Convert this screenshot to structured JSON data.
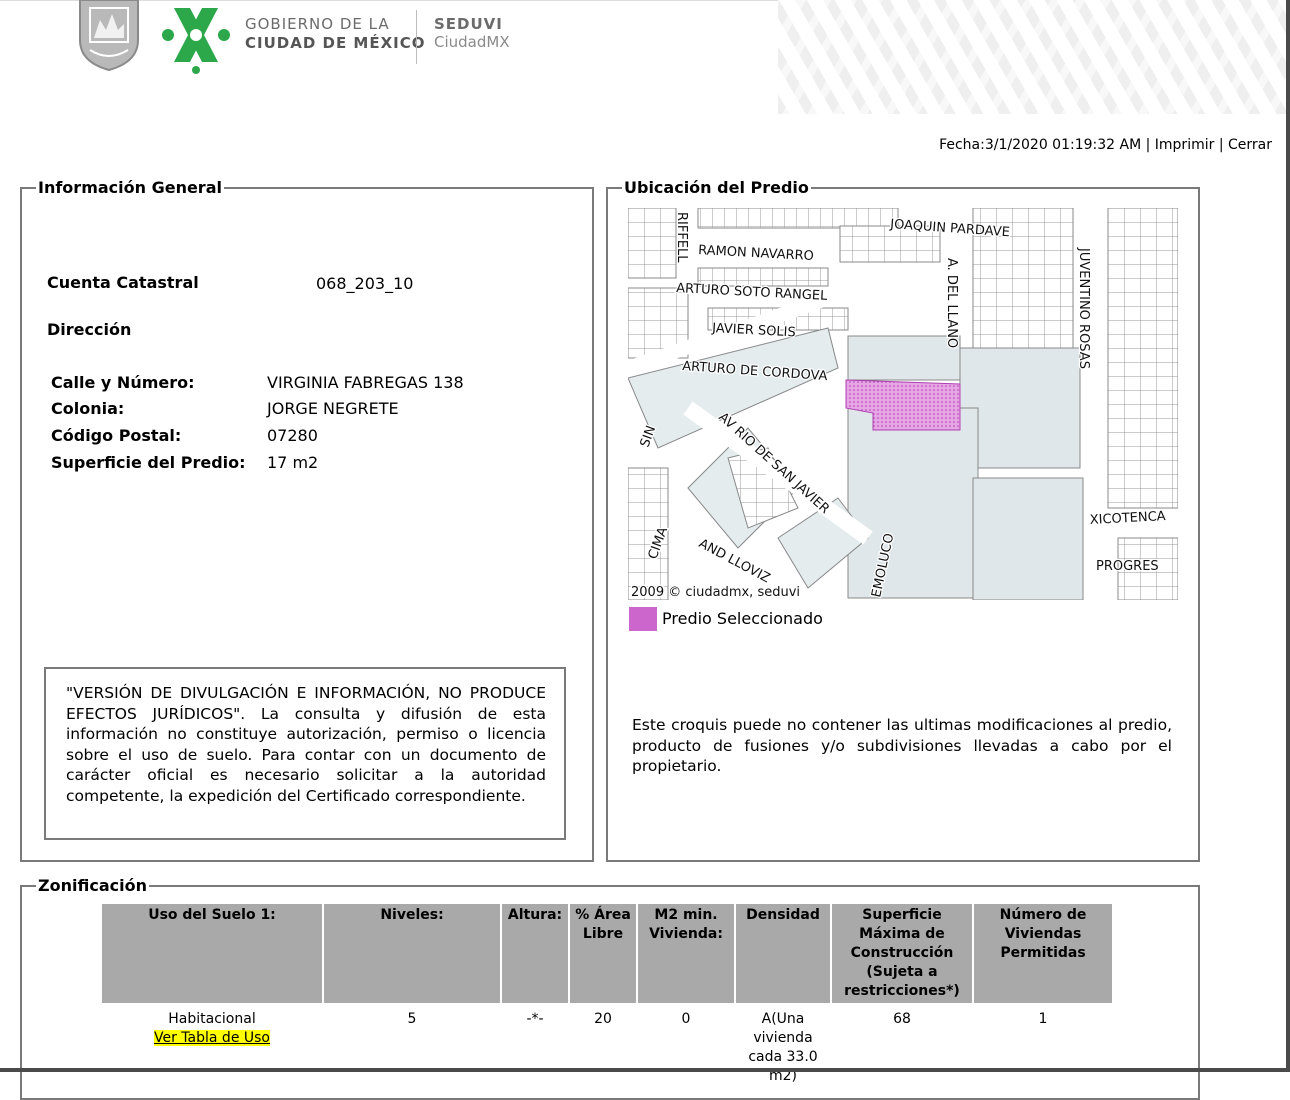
{
  "header": {
    "gov_line1": "GOBIERNO DE LA",
    "gov_line2": "CIUDAD DE MÉXICO",
    "agency": "SEDUVI",
    "agency_sub": "CiudadMX",
    "brand_green": "#2ca84a"
  },
  "topbar": {
    "fecha": "Fecha:3/1/2020 01:19:32 AM",
    "sep": " | ",
    "print_label": "Imprimir",
    "close_label": "Cerrar"
  },
  "general": {
    "legend": "Información General",
    "cuenta_label": "Cuenta Catastral",
    "cuenta_value": "068_203_10",
    "direccion_label": "Dirección",
    "fields": [
      {
        "label": "Calle y Número:",
        "value": "VIRGINIA FABREGAS 138"
      },
      {
        "label": "Colonia:",
        "value": "JORGE NEGRETE"
      },
      {
        "label": "Código Postal:",
        "value": "07280"
      },
      {
        "label": "Superficie del Predio:",
        "value": "17 m2"
      }
    ],
    "notice": "\"VERSIÓN DE DIVULGACIÓN E INFORMACIÓN, NO PRODUCE EFECTOS JURÍDICOS\". La consulta y difusión de esta información no constituye autorización, permiso o licencia sobre el uso de suelo. Para contar con un documento de carácter oficial es necesario solicitar a la autoridad competente, la expedición del Certificado correspondiente."
  },
  "ubicacion": {
    "legend": "Ubicación del Predio",
    "streets": [
      "JOAQUIN PARDAVE",
      "RIFFELL",
      "RAMON NAVARRO",
      "A. DEL LLANO",
      "JUVENTINO ROSAS",
      "ARTURO SOTO RANGEL",
      "JAVIER SOLIS",
      "ARTURO DE CORDOVA",
      "AV RIO DE SAN JAVIER",
      "SIN",
      "CIMA",
      "AND LLOVIZ",
      "EMOLUCO",
      "XICOTENCA",
      "PROGRES"
    ],
    "copyright": "2009 © ciudadmx, seduvi",
    "legend_label": "Predio Seleccionado",
    "predio_color": "#cc66cc",
    "croquis_note": "Este croquis puede no contener las ultimas modificaciones al predio, producto de fusiones y/o subdivisiones llevadas a cabo por el propietario."
  },
  "zonificacion": {
    "legend": "Zonificación",
    "headers": [
      "Uso del Suelo 1:",
      "Niveles:",
      "Altura:",
      "% Área Libre",
      "M2 min. Vivienda:",
      "Densidad",
      "Superficie Máxima de Construcción (Sujeta a restricciones*)",
      "Número de Viviendas Permitidas"
    ],
    "row": {
      "uso": "Habitacional",
      "uso_link": "Ver Tabla de Uso",
      "niveles": "5",
      "altura": "-*-",
      "area_libre": "20",
      "m2_min": "0",
      "densidad": "A(Una vivienda cada 33.0 m2)",
      "superficie_max": "68",
      "num_viviendas": "1"
    }
  }
}
